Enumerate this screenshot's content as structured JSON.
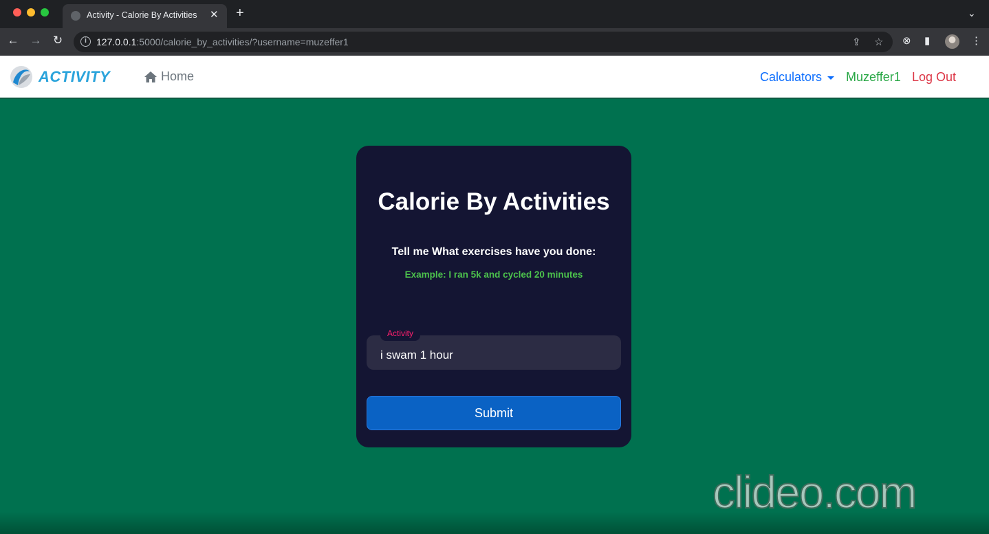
{
  "browser": {
    "tab_title": "Activity - Calorie By Activities",
    "url_host": "127.0.0.1",
    "url_rest": ":5000/calorie_by_activities/?username=muzeffer1"
  },
  "navbar": {
    "brand": "ACTIVITY",
    "home_label": "Home",
    "calculators_label": "Calculators",
    "username": "Muzeffer1",
    "logout_label": "Log Out"
  },
  "card": {
    "title": "Calorie By Activities",
    "prompt": "Tell me What exercises have you done:",
    "example": "Example: I ran 5k and cycled 20 minutes",
    "field_label": "Activity",
    "field_value": "i swam 1 hour",
    "submit_label": "Submit"
  },
  "watermark": "clideo.com",
  "colors": {
    "page_background": "#00714f",
    "card_background": "#141533",
    "submit_button": "#0a62c4",
    "example_text": "#4cc24c",
    "field_label": "#ff1f6e",
    "brand": "#29a3db",
    "calculators_link": "#0d6efd",
    "username_link": "#28a745",
    "logout_link": "#dc3545"
  },
  "icons": [
    "info-icon",
    "share-icon",
    "star-icon",
    "extensions-icon",
    "sidebar-icon",
    "more-icon",
    "home-icon",
    "close-icon",
    "plus-icon",
    "back-icon",
    "forward-icon",
    "reload-icon",
    "chevron-down-icon"
  ]
}
